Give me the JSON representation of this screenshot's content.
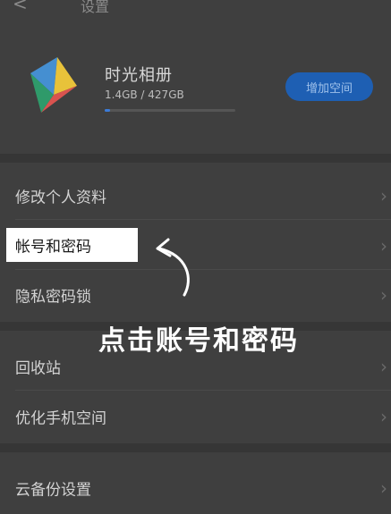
{
  "header": {
    "back_glyph": "<",
    "title": "设置"
  },
  "album": {
    "name": "时光相册",
    "usage": "1.4GB / 427GB",
    "usage_fraction": 0.0033,
    "add_space_label": "增加空间"
  },
  "menu": {
    "edit_profile": "修改个人资料",
    "account_password": "帐号和密码",
    "privacy_lock": "隐私密码锁",
    "recycle_bin": "回收站",
    "optimize_space": "优化手机空间",
    "cloud_backup": "云备份设置"
  },
  "overlay": {
    "caption": "点击账号和密码"
  },
  "colors": {
    "background": "#3f3f3f",
    "accent": "#1e5fb3"
  }
}
